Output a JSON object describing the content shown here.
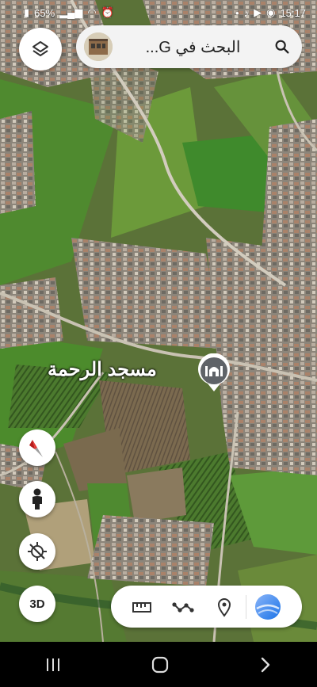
{
  "status_bar": {
    "battery": "65%",
    "time": "15:17",
    "icons": [
      "battery-icon",
      "signal-icon",
      "4g-icon",
      "wifi-icon",
      "alarm-icon",
      "dot-icon",
      "tiktok-icon",
      "youtube-icon",
      "messenger-icon"
    ]
  },
  "search": {
    "text": "البحث في G...",
    "icon": "search-icon"
  },
  "map": {
    "type": "satellite",
    "place_label": "مسجد الرحمة",
    "place_icon": "mosque-pin-icon"
  },
  "buttons": {
    "layers": "layers-icon",
    "compass": "compass-icon",
    "street_view": "pegman-icon",
    "location": "location-off-icon",
    "three_d_label": "3D"
  },
  "toolbar": {
    "items": [
      "ruler-icon",
      "path-icon",
      "pin-icon",
      "earth-globe-icon"
    ]
  },
  "nav": {
    "items": [
      "recent-apps-icon",
      "home-icon",
      "back-icon"
    ]
  },
  "colors": {
    "accent": "#4285f4",
    "compass_red": "#e53935",
    "pin_gray": "#5f6368"
  }
}
